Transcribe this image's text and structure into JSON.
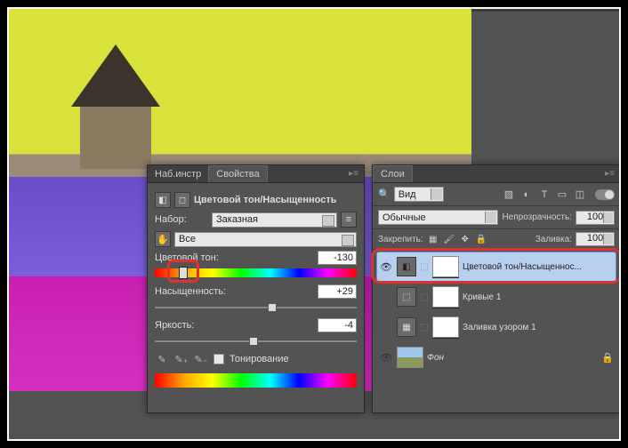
{
  "properties": {
    "tab_inactive": "Наб.инстр",
    "tab_active": "Свойства",
    "adjustment_title": "Цветовой тон/Насыщенность",
    "preset_label": "Набор:",
    "preset_value": "Заказная",
    "channel_value": "Все",
    "hue_label": "Цветовой тон:",
    "hue_value": "-130",
    "sat_label": "Насыщенность:",
    "sat_value": "+29",
    "light_label": "Яркость:",
    "light_value": "-4",
    "colorize_label": "Тонирование"
  },
  "layers": {
    "tab": "Слои",
    "kind": "Вид",
    "blend_mode": "Обычные",
    "opacity_label": "Непрозрачность:",
    "opacity_value": "100%",
    "lock_label": "Закрепить:",
    "fill_label": "Заливка:",
    "fill_value": "100%",
    "items": [
      {
        "name": "Цветовой тон/Насыщеннос...",
        "icon": "◧",
        "visible": true,
        "selected": true
      },
      {
        "name": "Кривые 1",
        "icon": "⬚",
        "visible": false,
        "selected": false
      },
      {
        "name": "Заливка узором 1",
        "icon": "▦",
        "visible": false,
        "selected": false
      }
    ],
    "background_name": "Фон"
  }
}
